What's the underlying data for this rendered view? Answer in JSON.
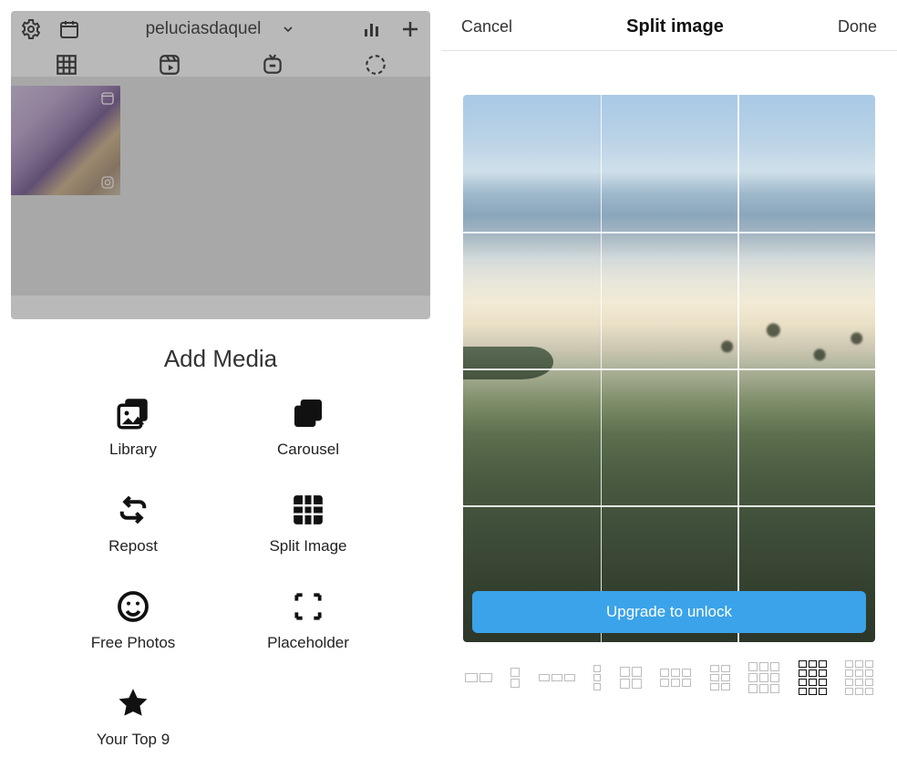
{
  "left": {
    "username": "peluciasdaquel",
    "icons": {
      "settings": "settings-icon",
      "calendar": "calendar-icon",
      "analytics": "analytics-icon",
      "add": "plus-icon"
    },
    "tabs": [
      "grid",
      "reels",
      "igtv",
      "story"
    ],
    "add_media_title": "Add Media",
    "media_options": [
      {
        "key": "library",
        "label": "Library"
      },
      {
        "key": "carousel",
        "label": "Carousel"
      },
      {
        "key": "repost",
        "label": "Repost"
      },
      {
        "key": "split_image",
        "label": "Split Image"
      },
      {
        "key": "free_photos",
        "label": "Free Photos"
      },
      {
        "key": "placeholder",
        "label": "Placeholder"
      },
      {
        "key": "your_top_9",
        "label": "Your Top 9"
      }
    ]
  },
  "right": {
    "header": {
      "cancel": "Cancel",
      "title": "Split image",
      "done": "Done"
    },
    "upgrade_label": "Upgrade to unlock",
    "grid": {
      "cols": 3,
      "rows": 4
    },
    "layouts": [
      {
        "id": "1x2",
        "rows": 1,
        "cols": 2,
        "selected": false
      },
      {
        "id": "2x1",
        "rows": 2,
        "cols": 1,
        "selected": false
      },
      {
        "id": "1x3",
        "rows": 1,
        "cols": 3,
        "selected": false
      },
      {
        "id": "3x1",
        "rows": 3,
        "cols": 1,
        "selected": false
      },
      {
        "id": "2x2",
        "rows": 2,
        "cols": 2,
        "selected": false
      },
      {
        "id": "2x3",
        "rows": 2,
        "cols": 3,
        "selected": false
      },
      {
        "id": "3x2",
        "rows": 3,
        "cols": 2,
        "selected": false
      },
      {
        "id": "3x3",
        "rows": 3,
        "cols": 3,
        "selected": false
      },
      {
        "id": "4x3",
        "rows": 4,
        "cols": 3,
        "selected": true
      },
      {
        "id": "4x3b",
        "rows": 4,
        "cols": 3,
        "selected": false
      }
    ]
  }
}
